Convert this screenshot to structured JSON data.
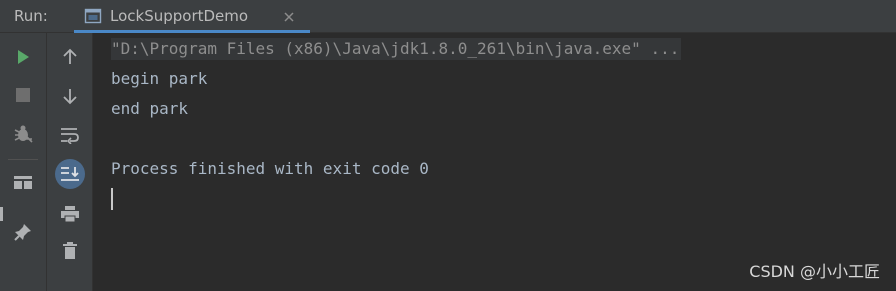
{
  "header": {
    "run_label": "Run:",
    "tab": {
      "title": "LockSupportDemo",
      "icon": "console-window-icon",
      "close_icon": "close-icon"
    },
    "accent_color": "#4A88C7"
  },
  "toolbar": {
    "left_column": [
      {
        "name": "rerun-button",
        "icon": "play-icon",
        "color": "#59A869"
      },
      {
        "name": "stop-button",
        "icon": "stop-icon",
        "color": "#6E6E6E"
      },
      {
        "name": "debug-rerun-button",
        "icon": "bug-icon",
        "color": "#8C8C8C"
      },
      {
        "name": "layout-button",
        "icon": "layout-icon",
        "color": "#AFB1B3"
      },
      {
        "name": "pin-tab-button",
        "icon": "pin-icon",
        "color": "#AFB1B3"
      }
    ],
    "right_column": [
      {
        "name": "scroll-up-button",
        "icon": "arrow-up-icon"
      },
      {
        "name": "scroll-down-button",
        "icon": "arrow-down-icon"
      },
      {
        "name": "soft-wrap-button",
        "icon": "soft-wrap-icon"
      },
      {
        "name": "scroll-to-end-button",
        "icon": "scroll-to-end-icon",
        "active": true
      },
      {
        "name": "print-button",
        "icon": "print-icon"
      },
      {
        "name": "clear-all-button",
        "icon": "trash-icon"
      }
    ]
  },
  "console": {
    "lines": [
      "\"D:\\Program Files (x86)\\Java\\jdk1.8.0_261\\bin\\java.exe\" ...",
      "begin park",
      "end park",
      "",
      "Process finished with exit code 0"
    ]
  },
  "watermark": "CSDN @小小工匠"
}
